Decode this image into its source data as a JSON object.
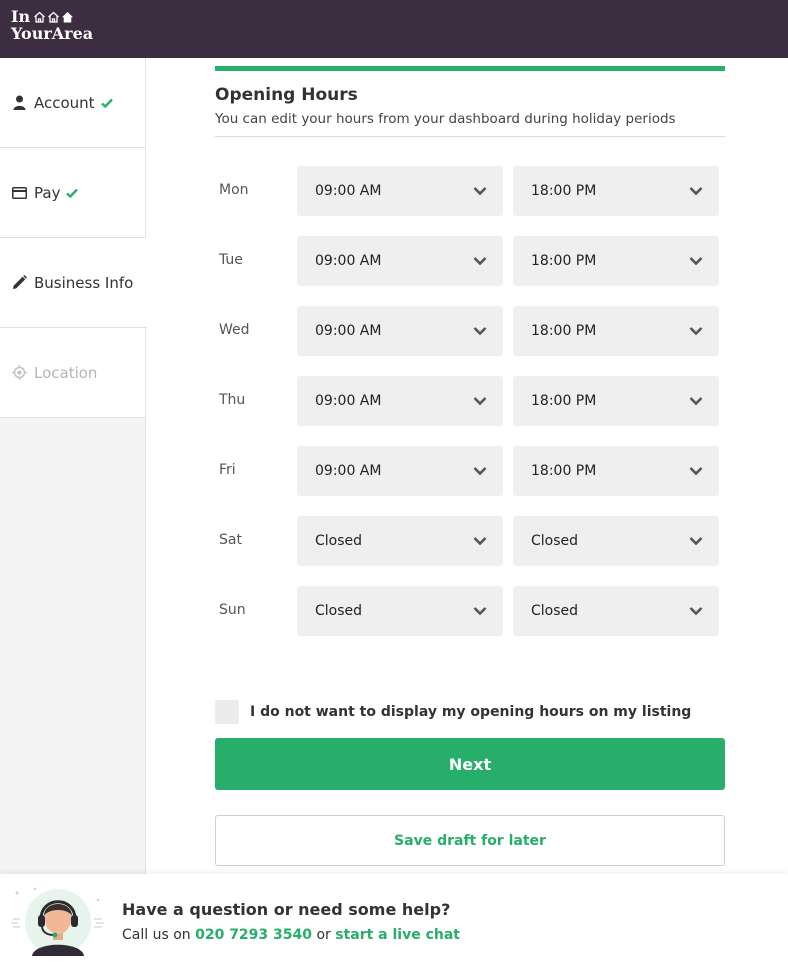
{
  "brand": {
    "line1": "In",
    "line2": "YourArea"
  },
  "sidebar": {
    "items": [
      {
        "label": "Account",
        "icon": "person-icon",
        "state": "complete"
      },
      {
        "label": "Pay",
        "icon": "card-icon",
        "state": "complete"
      },
      {
        "label": "Business Info",
        "icon": "pencil-icon",
        "state": "active"
      },
      {
        "label": "Location",
        "icon": "location-icon",
        "state": "disabled"
      }
    ]
  },
  "form": {
    "title": "Opening Hours",
    "subtitle": "You can edit your hours from your dashboard during holiday periods",
    "progress_fraction": 1.0,
    "days": [
      {
        "day": "Mon",
        "open": "09:00 AM",
        "close": "18:00 PM"
      },
      {
        "day": "Tue",
        "open": "09:00 AM",
        "close": "18:00 PM"
      },
      {
        "day": "Wed",
        "open": "09:00 AM",
        "close": "18:00 PM"
      },
      {
        "day": "Thu",
        "open": "09:00 AM",
        "close": "18:00 PM"
      },
      {
        "day": "Fri",
        "open": "09:00 AM",
        "close": "18:00 PM"
      },
      {
        "day": "Sat",
        "open": "Closed",
        "close": "Closed"
      },
      {
        "day": "Sun",
        "open": "Closed",
        "close": "Closed"
      }
    ],
    "optout_label": "I do not want to display my opening hours on my listing",
    "optout_checked": false,
    "next_label": "Next",
    "draft_label": "Save draft for later"
  },
  "help": {
    "question": "Have a question or need some help?",
    "call_prefix": "Call us on",
    "phone": "020 7293 3540",
    "or": "or",
    "chat_link": "start a live chat"
  },
  "colors": {
    "brand_bar": "#3c2e40",
    "accent": "#27ae6b",
    "field_bg": "#efefef"
  }
}
